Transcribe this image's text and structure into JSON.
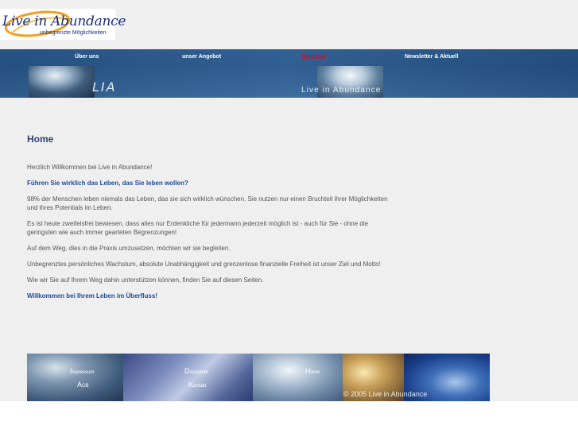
{
  "logo": {
    "title": "Live in Abundance",
    "subtitle": "unbegrenzte Möglichkeiten"
  },
  "nav": {
    "items": [
      {
        "label": "Über uns"
      },
      {
        "label": "unser Angebot"
      },
      {
        "label": "Spezial"
      },
      {
        "label": "Newsletter & Aktuell"
      }
    ]
  },
  "banner": {
    "left_text": "LIA",
    "right_text": "Live in Abundance"
  },
  "content": {
    "heading": "Home",
    "paragraphs": [
      "Herzlich Willkommen bei Live in Abundance!",
      "Führen Sie wirklich das Leben, das Sie leben wollen?",
      "98% der Menschen leben niemals das Leben, das sie sich wirklich wünschen. Sie nutzen nur einen Bruchteil ihrer Möglichkeiten und ihres Potentials im Leben.",
      "Es ist heute zweifelsfrei bewiesen, dass alles nur Erdenkliche für jedermann jederzeit möglich ist - auch für Sie - ohne die geringsten wie auch immer gearteten Begrenzungen!",
      "Auf dem Weg, dies in die Praxis umzusetzen, möchten wir sie begleiten.",
      "Unbegrenztes persönliches Wachstum, absolute Unabhängigkeit und grenzenlose finanzielle Freiheit ist unser Ziel und Motto!",
      "Wie wir Sie auf Ihrem Weg dahin unterstützen können, finden Sie auf diesen Seiten.",
      "Willkommen bei Ihrem Leben im Überfluss!"
    ]
  },
  "footer": {
    "links": [
      {
        "cap": "I",
        "rest": "mpressum"
      },
      {
        "cap": "A",
        "rest": "GB"
      },
      {
        "cap": "D",
        "rest": "isclaimer"
      },
      {
        "cap": "K",
        "rest": "ontakt"
      },
      {
        "cap": "H",
        "rest": "ome"
      }
    ],
    "copyright": "© 2005 Live in Abundance"
  }
}
